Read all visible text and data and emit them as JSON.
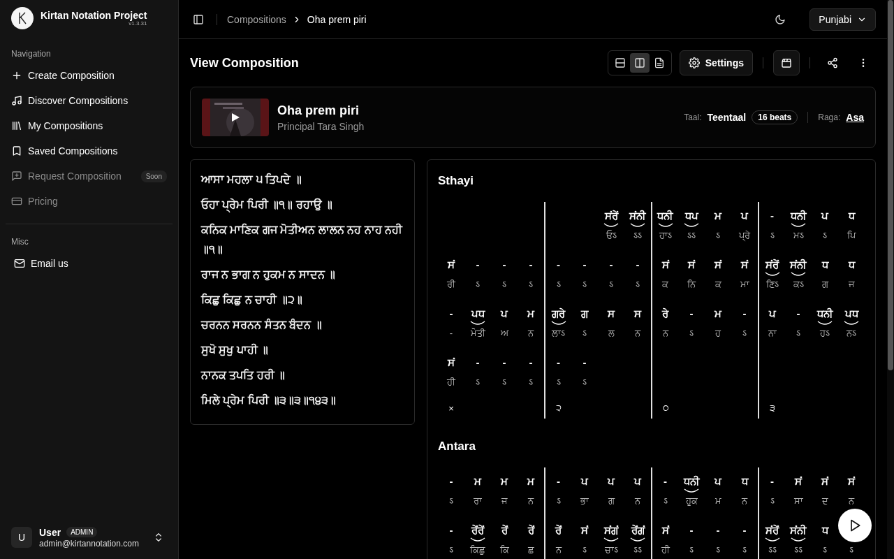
{
  "sidebar": {
    "app_name": "Kirtan Notation Project",
    "version": "v1.3.31",
    "sections": [
      {
        "title": "Navigation",
        "items": [
          {
            "label": "Create Composition",
            "disabled": false
          },
          {
            "label": "Discover Compositions",
            "disabled": false
          },
          {
            "label": "My Compositions",
            "disabled": false
          },
          {
            "label": "Saved Compositions",
            "disabled": false
          },
          {
            "label": "Request Composition",
            "disabled": true,
            "badge": "Soon"
          },
          {
            "label": "Pricing",
            "disabled": true
          }
        ]
      },
      {
        "title": "Misc",
        "items": [
          {
            "label": "Email us",
            "disabled": false
          }
        ]
      }
    ],
    "user": {
      "initial": "U",
      "name": "User",
      "role": "ADMIN",
      "email": "admin@kirtannotation.com"
    }
  },
  "header": {
    "breadcrumbs": [
      {
        "label": "Compositions",
        "current": false
      },
      {
        "label": "Oha prem piri",
        "current": true
      }
    ],
    "language": "Punjabi"
  },
  "toolbar": {
    "title": "View Composition",
    "views": [
      {
        "selected": false
      },
      {
        "selected": true
      },
      {
        "selected": false
      }
    ],
    "settings_label": "Settings"
  },
  "composition": {
    "title": "Oha prem piri",
    "artist": "Principal Tara Singh",
    "taal_label": "Taal:",
    "taal": "Teentaal",
    "beats": "16 beats",
    "raga_label": "Raga:",
    "raga": "Asa"
  },
  "lyrics": [
    "ਆਸਾ ਮਹਲਾ ੫ ਤਿਪਦੇ ॥",
    "ਓਹਾ ਪ੍ਰੇਮ ਪਿਰੀ ॥੧॥ ਰਹਾਉ ॥",
    "ਕਨਿਕ ਮਾਣਿਕ ਗਜ ਮੋਤੀਅਨ ਲਾਲਨ ਨਹ ਨਾਹ ਨਹੀ ॥੧॥",
    "ਰਾਜ ਨ ਭਾਗ ਨ ਹੁਕਮ ਨ ਸਾਦਨ ॥",
    "ਕਿਛੁ ਕਿਛੁ ਨ ਚਾਹੀ ॥੨॥",
    "ਚਰਨਨ ਸਰਨਨ ਸੰਤਨ ਬੰਦਨ ॥",
    "ਸੁਖੋ ਸੁਖੁ ਪਾਹੀ ॥",
    "ਨਾਨਕ ਤਪਤਿ ਹਰੀ ॥",
    "ਮਿਲੇ ਪ੍ਰੇਮ ਪਿਰੀ ॥੩॥੩॥੧੪੩॥"
  ],
  "notation": {
    "sections": [
      {
        "title": "Sthayi",
        "taal_marks": [
          "×",
          "੨",
          "੦",
          "੩"
        ],
        "rows": [
          {
            "cells": [
              {},
              {},
              {},
              {},
              {},
              {},
              {
                "note": "ਸਂਰੇਂ",
                "lyric": "ਓऽ",
                "slur": true
              },
              {
                "note": "ਸਂਨੀ",
                "lyric": "ऽऽ",
                "slur": true
              },
              {
                "note": "ਧਨੀ",
                "lyric": "ਹਾऽ",
                "slur": true
              },
              {
                "note": "ਧਪ",
                "lyric": "ऽऽ",
                "slur": true
              },
              {
                "note": "ਮ",
                "lyric": "ऽ",
                "slur": false
              },
              {
                "note": "ਪ",
                "lyric": "ਪ੍ਰੇ",
                "slur": false
              },
              {
                "note": "-",
                "lyric": "ऽ",
                "slur": false
              },
              {
                "note": "ਧਨੀ",
                "lyric": "ਮऽ",
                "slur": true
              },
              {
                "note": "ਪ",
                "lyric": "ऽ",
                "slur": false
              },
              {
                "note": "ਧ",
                "lyric": "ਪਿ",
                "slur": false
              }
            ]
          },
          {
            "cells": [
              {
                "note": "ਸਂ",
                "lyric": "ਰੀ",
                "slur": false
              },
              {
                "note": "-",
                "lyric": "ऽ",
                "slur": false
              },
              {
                "note": "-",
                "lyric": "ऽ",
                "slur": false
              },
              {
                "note": "-",
                "lyric": "ऽ",
                "slur": false
              },
              {
                "note": "-",
                "lyric": "ऽ",
                "slur": false
              },
              {
                "note": "-",
                "lyric": "ऽ",
                "slur": false
              },
              {
                "note": "-",
                "lyric": "ऽ",
                "slur": false
              },
              {
                "note": "-",
                "lyric": "ऽ",
                "slur": false
              },
              {
                "note": "ਸਂ",
                "lyric": "ਕ",
                "slur": false
              },
              {
                "note": "ਸਂ",
                "lyric": "ਨਿ",
                "slur": false
              },
              {
                "note": "ਸਂ",
                "lyric": "ਕ",
                "slur": false
              },
              {
                "note": "ਸਂ",
                "lyric": "ਮਾ",
                "slur": false
              },
              {
                "note": "ਸਂਰੇਂ",
                "lyric": "ਣਿऽ",
                "slur": true
              },
              {
                "note": "ਸਂਨੀ",
                "lyric": "ਕऽ",
                "slur": true
              },
              {
                "note": "ਧ",
                "lyric": "ਗ",
                "slur": false
              },
              {
                "note": "ਧ",
                "lyric": "ਜ",
                "slur": false
              }
            ]
          },
          {
            "cells": [
              {
                "note": "-",
                "lyric": "-",
                "slur": false
              },
              {
                "note": "ਪਧ",
                "lyric": "ਮੋਤੀ",
                "slur": true
              },
              {
                "note": "ਪ",
                "lyric": "ਅ",
                "slur": false
              },
              {
                "note": "ਮ",
                "lyric": "ਨ",
                "slur": false
              },
              {
                "note": "ਗਰੇ",
                "lyric": "ਲਾऽ",
                "slur": true
              },
              {
                "note": "ਗ",
                "lyric": "ऽ",
                "slur": false
              },
              {
                "note": "ਸ",
                "lyric": "ਲ",
                "slur": false
              },
              {
                "note": "ਸ",
                "lyric": "ਨ",
                "slur": false
              },
              {
                "note": "ਰੇ",
                "lyric": "ਨ",
                "slur": false
              },
              {
                "note": "-",
                "lyric": "ऽ",
                "slur": false
              },
              {
                "note": "ਮ",
                "lyric": "ਹ",
                "slur": false
              },
              {
                "note": "-",
                "lyric": "ऽ",
                "slur": false
              },
              {
                "note": "ਪ",
                "lyric": "ਨਾ",
                "slur": false
              },
              {
                "note": "-",
                "lyric": "ऽ",
                "slur": false
              },
              {
                "note": "ਧਨੀ",
                "lyric": "ਹऽ",
                "slur": true
              },
              {
                "note": "ਪਧ",
                "lyric": "ਨऽ",
                "slur": true
              }
            ]
          },
          {
            "cells": [
              {
                "note": "ਸਂ",
                "lyric": "ਹੀ",
                "slur": false
              },
              {
                "note": "-",
                "lyric": "ऽ",
                "slur": false
              },
              {
                "note": "-",
                "lyric": "ऽ",
                "slur": false
              },
              {
                "note": "-",
                "lyric": "ऽ",
                "slur": false
              },
              {
                "note": "-",
                "lyric": "ऽ",
                "slur": false
              },
              {
                "note": "-",
                "lyric": "ऽ",
                "slur": false
              },
              {},
              {},
              {},
              {},
              {},
              {},
              {},
              {},
              {},
              {}
            ]
          }
        ]
      },
      {
        "title": "Antara",
        "rows": [
          {
            "cells": [
              {
                "note": "-",
                "lyric": "ऽ",
                "slur": false
              },
              {
                "note": "ਮ",
                "lyric": "ਰਾ",
                "slur": false
              },
              {
                "note": "ਮ",
                "lyric": "ਜ",
                "slur": false
              },
              {
                "note": "ਮ",
                "lyric": "ਨ",
                "slur": false
              },
              {
                "note": "-",
                "lyric": "ऽ",
                "slur": false
              },
              {
                "note": "ਪ",
                "lyric": "ਭਾ",
                "slur": false
              },
              {
                "note": "ਪ",
                "lyric": "ਗ",
                "slur": false
              },
              {
                "note": "ਪ",
                "lyric": "ਨ",
                "slur": false
              },
              {
                "note": "-",
                "lyric": "ऽ",
                "slur": false
              },
              {
                "note": "ਧਨੀ",
                "lyric": "ਹੁਕ",
                "slur": true
              },
              {
                "note": "ਪ",
                "lyric": "ਮ",
                "slur": false
              },
              {
                "note": "ਧ",
                "lyric": "ਨ",
                "slur": false
              },
              {
                "note": "-",
                "lyric": "ऽ",
                "slur": false
              },
              {
                "note": "ਸਂ",
                "lyric": "ਸਾ",
                "slur": false
              },
              {
                "note": "ਸਂ",
                "lyric": "ਦ",
                "slur": false
              },
              {
                "note": "ਸਂ",
                "lyric": "ਨ",
                "slur": false
              }
            ]
          },
          {
            "cells": [
              {
                "note": "-",
                "lyric": "ऽ",
                "slur": false
              },
              {
                "note": "ਰੇਂਰੇਂ",
                "lyric": "ਕਿਛੁ",
                "slur": true
              },
              {
                "note": "ਰੇਂ",
                "lyric": "ਕਿ",
                "slur": false
              },
              {
                "note": "ਰੇਂ",
                "lyric": "ਛ",
                "slur": false
              },
              {
                "note": "ਰੇਂ",
                "lyric": "ਨ",
                "slur": false
              },
              {
                "note": "ਸਂ",
                "lyric": "ऽ",
                "slur": false
              },
              {
                "note": "ਸਂਗਂ",
                "lyric": "ਚਾऽ",
                "slur": true
              },
              {
                "note": "ਰੇਂਗਂ",
                "lyric": "ऽऽ",
                "slur": true
              },
              {
                "note": "ਸਂ",
                "lyric": "ਹੀ",
                "slur": false
              },
              {
                "note": "-",
                "lyric": "ऽ",
                "slur": false
              },
              {
                "note": "-",
                "lyric": "ऽ",
                "slur": false
              },
              {
                "note": "-",
                "lyric": "ऽ",
                "slur": false
              },
              {
                "note": "ਸਂਰੇਂ",
                "lyric": "ऽऽ",
                "slur": true
              },
              {
                "note": "ਸਂਨੀ",
                "lyric": "ऽऽ",
                "slur": true
              },
              {
                "note": "ਧ",
                "lyric": "ऽ",
                "slur": false
              },
              {
                "lyric": "ऽ"
              }
            ]
          }
        ]
      }
    ]
  }
}
